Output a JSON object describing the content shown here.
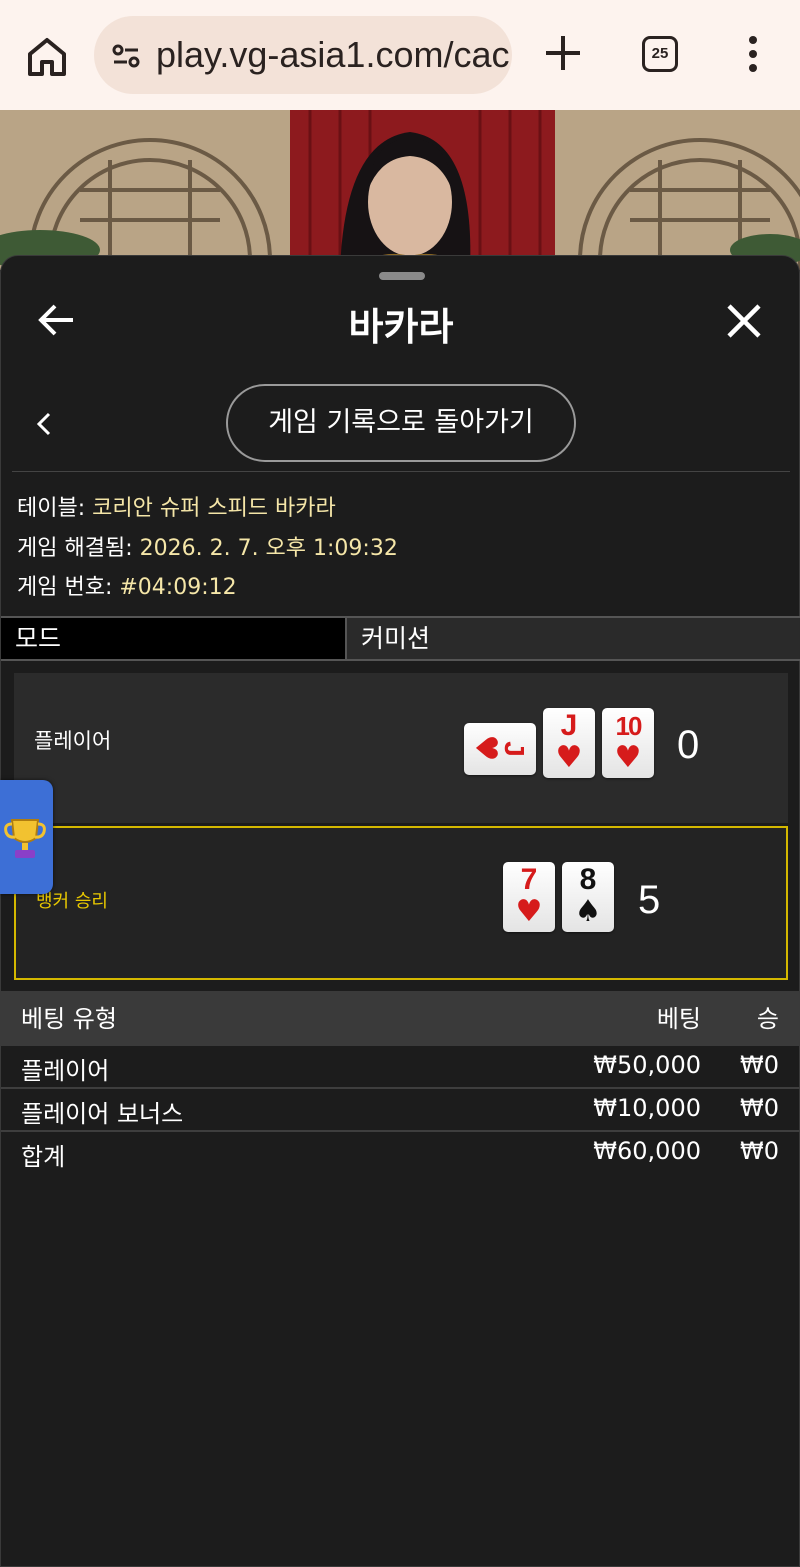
{
  "browser": {
    "url": "play.vg-asia1.com/cac",
    "tab_count": "25"
  },
  "panel": {
    "title": "바카라",
    "history_button": "게임 기록으로 돌아가기"
  },
  "info": {
    "table_label": "테이블: ",
    "table_value": "코리안 슈퍼 스피드 바카라",
    "resolved_label": "게임 해결됨: ",
    "resolved_value": "2026. 2. 7. 오후 1:09:32",
    "number_label": "게임 번호: ",
    "number_value": "#04:09:12"
  },
  "mode": {
    "label": "모드",
    "value": "커미션"
  },
  "player": {
    "label": "플레이어",
    "score": "0",
    "cards": [
      {
        "rank": "J",
        "suit": "♥",
        "color": "red",
        "orientation": "sideways"
      },
      {
        "rank": "J",
        "suit": "♥",
        "color": "red",
        "orientation": "upright"
      },
      {
        "rank": "10",
        "suit": "♥",
        "color": "red",
        "orientation": "upright"
      }
    ]
  },
  "banker": {
    "label": "뱅커 승리",
    "score": "5",
    "cards": [
      {
        "rank": "7",
        "suit": "♥",
        "color": "red",
        "orientation": "upright"
      },
      {
        "rank": "8",
        "suit": "♠",
        "color": "black",
        "orientation": "upright"
      }
    ]
  },
  "bets": {
    "headers": {
      "type": "베팅 유형",
      "bet": "베팅",
      "win": "승"
    },
    "rows": [
      {
        "type": "플레이어",
        "bet": "₩50,000",
        "win": "₩0"
      },
      {
        "type": "플레이어 보너스",
        "bet": "₩10,000",
        "win": "₩0"
      }
    ],
    "total": {
      "type": "합계",
      "bet": "₩60,000",
      "win": "₩0"
    }
  },
  "colors": {
    "accent_gold": "#d4b800",
    "info_value": "#f5e6a8",
    "panel_bg": "#1c1c1c",
    "red_suit": "#d61b1b",
    "trophy_tab": "#3d6fd6"
  },
  "icons": [
    "home-icon",
    "site-settings-icon",
    "new-tab-icon",
    "tabs-icon",
    "more-menu-icon",
    "back-arrow-icon",
    "close-icon",
    "chevron-left-icon",
    "trophy-icon"
  ]
}
